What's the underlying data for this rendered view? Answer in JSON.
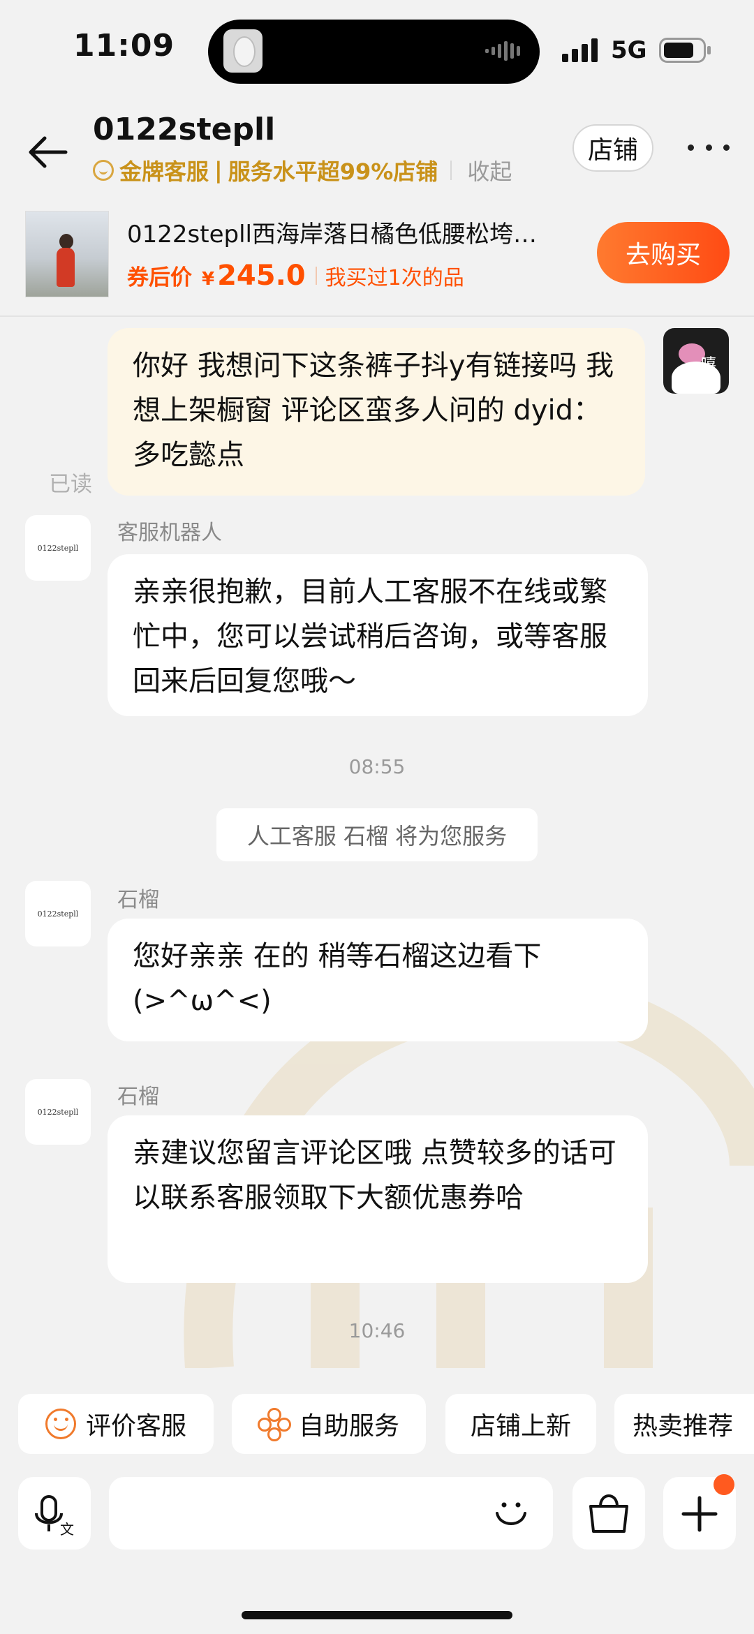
{
  "status_bar": {
    "time": "11:09",
    "network": "5G"
  },
  "header": {
    "shop_name": "0122stepll",
    "badge": "金牌客服",
    "badge_sep": "|",
    "service_level": "服务水平超99%店铺",
    "collapse": "收起",
    "store_button": "店铺"
  },
  "product": {
    "name": "0122stepll西海岸落日橘色低腰松垮…",
    "price_label": "券后价",
    "currency": "¥",
    "price": "245.0",
    "bought_note": "我买过1次的品",
    "buy_button": "去购买"
  },
  "messages": {
    "m1_text": "你好 我想问下这条裤子抖y有链接吗 我想上架橱窗 评论区蛮多人问的 dyid：多吃懿点",
    "m1_read": "已读",
    "my_avatar_text": "嘻嘻",
    "m2_sender": "客服机器人",
    "m2_text": "亲亲很抱歉，目前人工客服不在线或繁忙中，您可以尝试稍后咨询，或等客服回来后回复您哦～",
    "ts1": "08:55",
    "system_notice": "人工客服 石榴 将为您服务",
    "m3_sender": "石榴",
    "m3_text": "您好亲亲 在的 稍等石榴这边看下(>^ω^<)",
    "m4_sender": "石榴",
    "m4_text": "亲建议您留言评论区哦 点赞较多的话可以联系客服领取下大额优惠券哈",
    "ts2": "10:46",
    "avatar_text": "0122stepll"
  },
  "quick_actions": [
    "评价客服",
    "自助服务",
    "店铺上新",
    "热卖推荐"
  ],
  "input": {
    "placeholder": ""
  },
  "colors": {
    "accent": "#ff5000",
    "gold": "#c9921a",
    "my_bubble": "#fdf6e6"
  }
}
